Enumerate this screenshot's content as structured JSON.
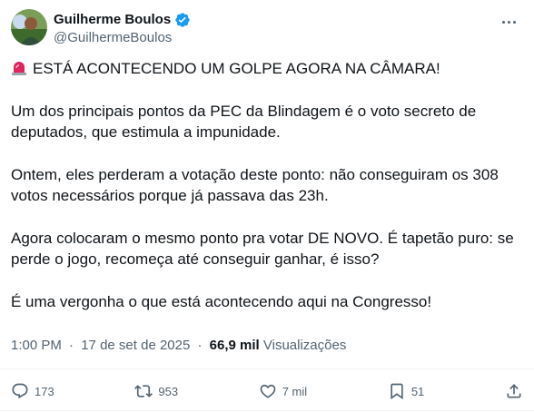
{
  "author": {
    "name": "Guilherme Boulos",
    "handle": "@GuilhermeBoulos",
    "verified_color": "#1d9bf0"
  },
  "tweet": {
    "line1": "ESTÁ ACONTECENDO UM GOLPE AGORA NA CÂMARA!",
    "para2": "Um dos principais pontos da PEC da Blindagem é o voto secreto de deputados, que estimula a impunidade.",
    "para3": "Ontem, eles perderam a votação deste ponto: não conseguiram os 308 votos necessários porque já passava das 23h.",
    "para4": "Agora colocaram o mesmo ponto pra votar DE NOVO. É tapetão puro: se perde o jogo, recomeça até conseguir ganhar, é isso?",
    "para5": "É uma vergonha o que está acontecendo aqui na Congresso!",
    "emoji_icon": "police-siren-icon"
  },
  "meta": {
    "time": "1:00 PM",
    "date": "17 de set de 2025",
    "views_count": "66,9 mil",
    "views_label": "Visualizações"
  },
  "actions": {
    "replies": "173",
    "reposts": "953",
    "likes": "7 mil",
    "bookmarks": "51"
  },
  "colors": {
    "text": "#0f1419",
    "secondary": "#536471",
    "divider": "#eff3f4"
  }
}
